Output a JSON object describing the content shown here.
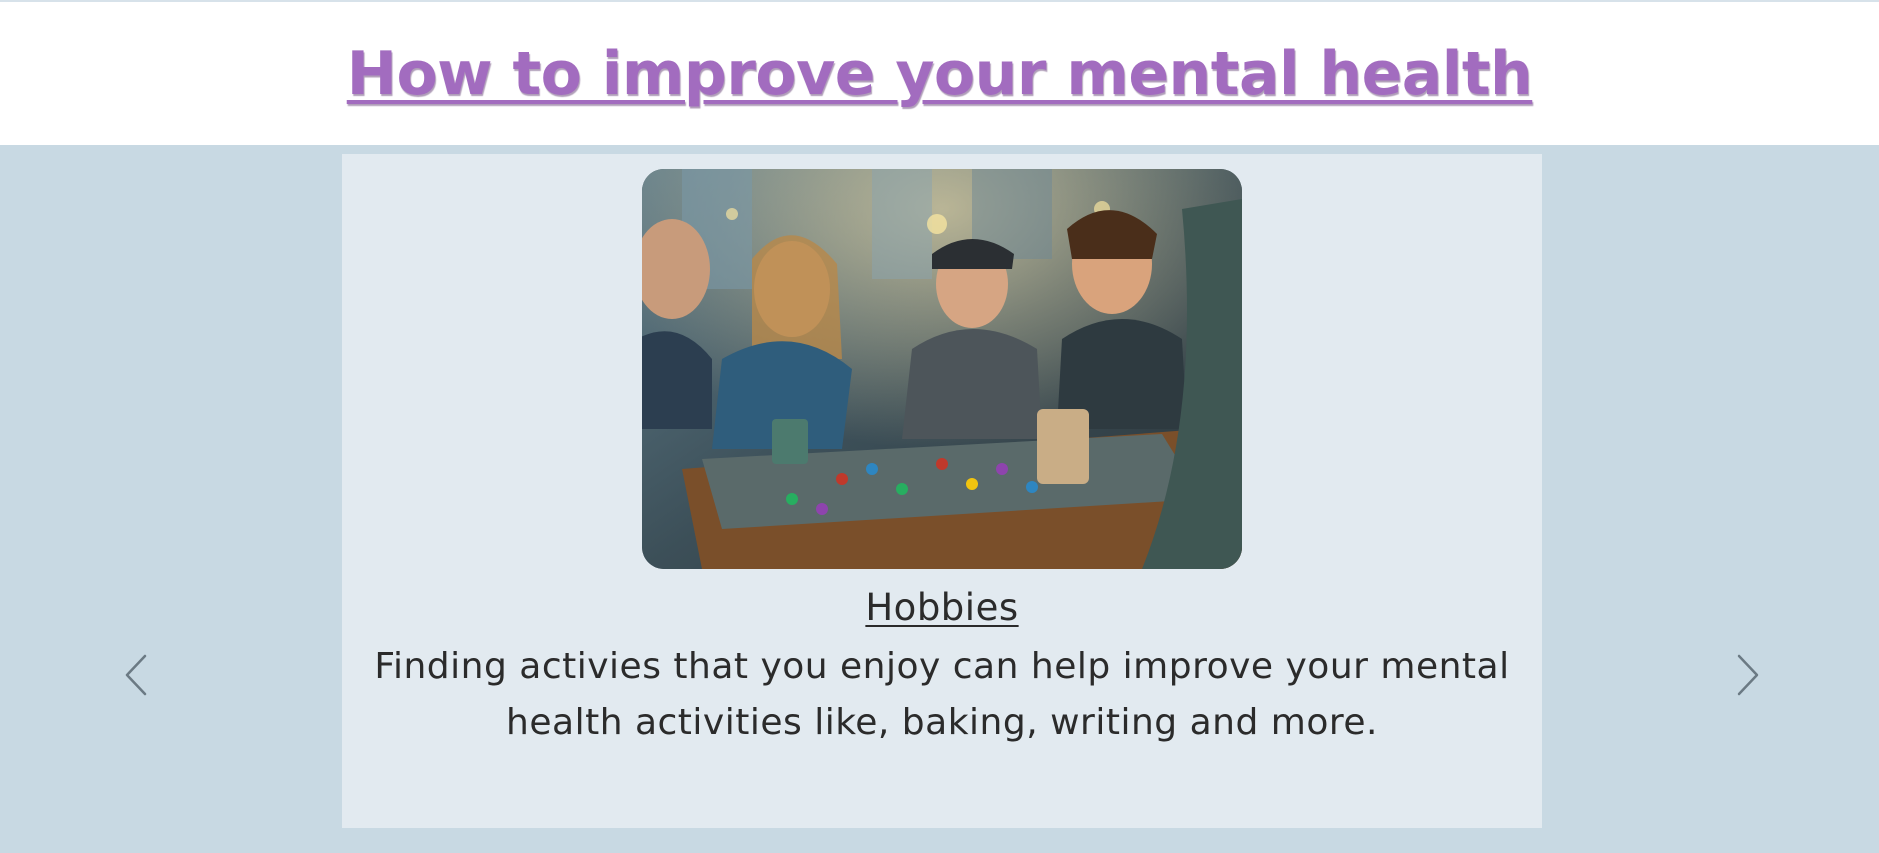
{
  "header": {
    "title": "How to improve your mental health"
  },
  "carousel": {
    "slide": {
      "image": "photo of friends playing a board game at a cafe table",
      "title": "Hobbies",
      "description": "Finding activies that you enjoy can help improve your mental health activities like, baking, writing and more."
    },
    "prev_icon": "chevron-left-icon",
    "next_icon": "chevron-right-icon"
  },
  "colors": {
    "title": "#a26cbf",
    "band_background": "#c8d9e3",
    "card_background": "#e2eaf0",
    "text": "#2b2b2b",
    "arrow": "#6b7a84"
  }
}
